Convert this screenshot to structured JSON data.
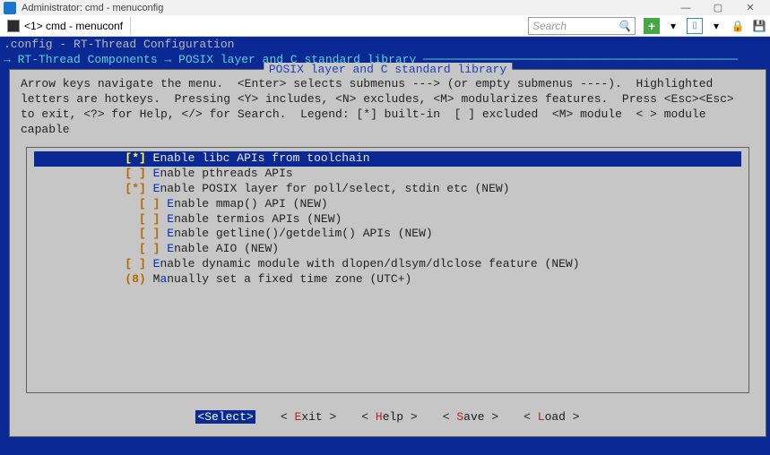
{
  "window": {
    "title": "Administrator: cmd - menuconfig",
    "tab_label": "<1> cmd - menuconf",
    "search_placeholder": "Search"
  },
  "header": {
    "line1": ".config - RT-Thread Configuration",
    "line2": "→ RT-Thread Components → POSIX layer and C standard library ─────────────────────────────────────────────"
  },
  "panel": {
    "title": "POSIX layer and C standard library",
    "instructions": "Arrow keys navigate the menu.  <Enter> selects submenus ---> (or empty submenus ----).  Highlighted letters are hotkeys.  Pressing <Y> includes, <N> excludes, <M> modularizes features.  Press <Esc><Esc> to exit, <?> for Help, </> for Search.  Legend: [*] built-in  [ ] excluded  <M> module  < > module capable"
  },
  "items": [
    {
      "pad": "",
      "state": "[*]",
      "hotkey": "E",
      "rest": "nable libc APIs from toolchain",
      "selected": true
    },
    {
      "pad": "",
      "state": "[ ]",
      "hotkey": "E",
      "rest": "nable pthreads APIs",
      "selected": false
    },
    {
      "pad": "",
      "state": "[*]",
      "hotkey": "E",
      "rest": "nable POSIX layer for poll/select, stdin etc (NEW)",
      "selected": false
    },
    {
      "pad": "  ",
      "state": "[ ]",
      "hotkey": "E",
      "rest": "nable mmap() API (NEW)",
      "selected": false
    },
    {
      "pad": "  ",
      "state": "[ ]",
      "hotkey": "E",
      "rest": "nable termios APIs (NEW)",
      "selected": false
    },
    {
      "pad": "  ",
      "state": "[ ]",
      "hotkey": "E",
      "rest": "nable getline()/getdelim() APIs (NEW)",
      "selected": false
    },
    {
      "pad": "  ",
      "state": "[ ]",
      "hotkey": "E",
      "rest": "nable AIO (NEW)",
      "selected": false
    },
    {
      "pad": "",
      "state": "[ ]",
      "hotkey": "E",
      "rest": "nable dynamic module with dlopen/dlsym/dlclose feature (NEW)",
      "selected": false
    },
    {
      "pad": "",
      "state": "(8)",
      "hotkey": "a",
      "rest": "nually set a fixed time zone (UTC+)",
      "pre": "M",
      "selected": false
    }
  ],
  "buttons": [
    {
      "label": "Select",
      "hotkey": "S",
      "rest": "elect",
      "active": true
    },
    {
      "label": "Exit",
      "hotkey": "E",
      "rest": "xit",
      "active": false
    },
    {
      "label": "Help",
      "hotkey": "H",
      "rest": "elp",
      "active": false
    },
    {
      "label": "Save",
      "hotkey": "S",
      "rest": "ave",
      "active": false
    },
    {
      "label": "Load",
      "hotkey": "L",
      "rest": "oad",
      "active": false
    }
  ]
}
